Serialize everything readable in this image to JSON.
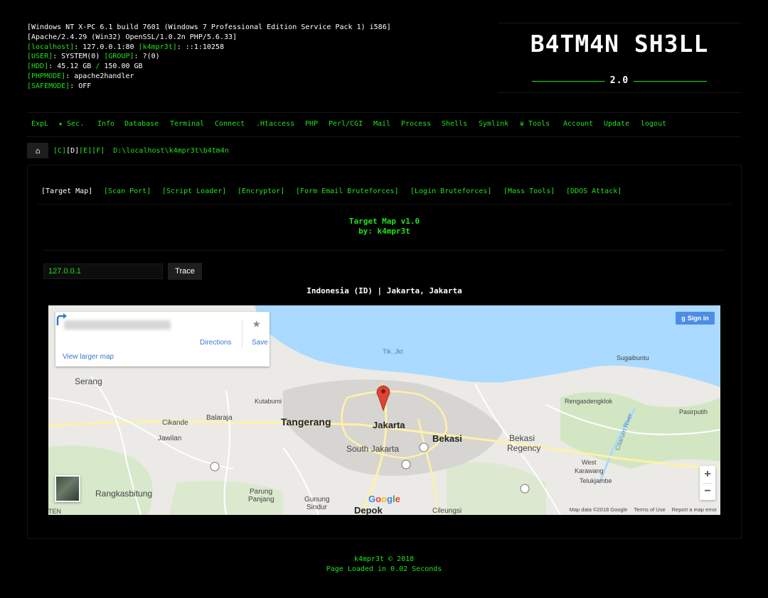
{
  "sysinfo": {
    "lines": [
      [
        {
          "t": "[Windows NT X-PC 6.1 build 7601 (Windows 7 Professional Edition Service Pack 1) i586]",
          "c": "w"
        }
      ],
      [
        {
          "t": "[Apache/2.4.29 (Win32) OpenSSL/1.0.2n PHP/5.6.33]",
          "c": "w"
        }
      ],
      [
        {
          "t": "[localhost]",
          "c": "g"
        },
        {
          "t": ": 127.0.0.1:80 ",
          "c": "w"
        },
        {
          "t": "[k4mpr3t]",
          "c": "g"
        },
        {
          "t": ": ::1:10258",
          "c": "w"
        }
      ],
      [
        {
          "t": "[USER]",
          "c": "g"
        },
        {
          "t": ": SYSTEM(0) ",
          "c": "w"
        },
        {
          "t": "[GROUP]",
          "c": "g"
        },
        {
          "t": ": ?(0)",
          "c": "w"
        }
      ],
      [
        {
          "t": "[HDD]",
          "c": "g"
        },
        {
          "t": ": 45.12 GB ",
          "c": "w"
        },
        {
          "t": "/",
          "c": "g"
        },
        {
          "t": " 150.00 GB",
          "c": "w"
        }
      ],
      [
        {
          "t": "[PHPMODE]",
          "c": "g"
        },
        {
          "t": ": apache2handler",
          "c": "w"
        }
      ],
      [
        {
          "t": "[SAFEMODE]",
          "c": "g"
        },
        {
          "t": ": OFF",
          "c": "w"
        }
      ]
    ]
  },
  "logo": {
    "title": "B4TM4N SH3LL",
    "version": "2.0"
  },
  "nav": {
    "items": [
      "ExpL",
      "★ Sec.",
      "Info",
      "Database",
      "Terminal",
      "Connect",
      ".Htaccess",
      "PHP",
      "Perl/CGI",
      "Mail",
      "Process",
      "Shells",
      "Symlink",
      "♛ Tools",
      "Account",
      "Update",
      "logout"
    ]
  },
  "pathbar": {
    "home_icon": "home-icon",
    "home_glyph": "⌂",
    "drives": [
      "[C]",
      "[D]",
      "[E]",
      "[F]"
    ],
    "current_drive": "[D]",
    "path": "D:\\localhost\\k4mpr3t\\b4tm4n"
  },
  "tools": {
    "items": [
      "[Target Map]",
      "[Scan Port]",
      "[Script Loader]",
      "[Encryptor]",
      "[Form Email Bruteforces]",
      "[Login Bruteforces]",
      "[Mass Tools]",
      "[DDOS Attack]"
    ],
    "active": "[Target Map]"
  },
  "target_map": {
    "title": "Target Map v1.0",
    "author": "by: k4mpr3t",
    "ip_value": "127.0.0.1",
    "trace_label": "Trace",
    "result": "Indonesia (ID) | Jakarta, Jakarta"
  },
  "map": {
    "directions_label": "Directions",
    "save_label": "Save",
    "view_larger": "View larger map",
    "signin_label": "Sign in",
    "zoom_in": "+",
    "zoom_out": "−",
    "google": "Google",
    "attribution": [
      "Map data ©2018 Google",
      "Terms of Use",
      "Report a map error"
    ],
    "places": [
      {
        "name": "Tlk. Jkt",
        "size": 9
      },
      {
        "name": "Sugaibuntu",
        "size": 9
      },
      {
        "name": "Serang",
        "size": 12
      },
      {
        "name": "Kutabumi",
        "size": 9
      },
      {
        "name": "Rengasdengklok",
        "size": 9
      },
      {
        "name": "Pasirputih",
        "size": 9
      },
      {
        "name": "Cikande",
        "size": 10
      },
      {
        "name": "Balaraja",
        "size": 10
      },
      {
        "name": "Tangerang",
        "size": 14
      },
      {
        "name": "Jakarta",
        "size": 13
      },
      {
        "name": "Citarum River",
        "size": 9
      },
      {
        "name": "Bekasi",
        "size": 13
      },
      {
        "name": "Bekasi",
        "size": 12
      },
      {
        "name": "Regency",
        "size": 12
      },
      {
        "name": "South Jakarta",
        "size": 12
      },
      {
        "name": "Jawilan",
        "size": 10
      },
      {
        "name": "West",
        "size": 9
      },
      {
        "name": "Karawang",
        "size": 9
      },
      {
        "name": "Telukjambe",
        "size": 9
      },
      {
        "name": "Rangkasbitung",
        "size": 12
      },
      {
        "name": "Parung",
        "size": 10
      },
      {
        "name": "Panjang",
        "size": 10
      },
      {
        "name": "Gunung",
        "size": 10
      },
      {
        "name": "Sindur",
        "size": 10
      },
      {
        "name": "Depok",
        "size": 13
      },
      {
        "name": "Cileungsi",
        "size": 10
      },
      {
        "name": "TEN",
        "size": 9
      }
    ]
  },
  "footer": {
    "credit": "k4mpr3t © 2018",
    "loaded": "Page Loaded in 0.02 Seconds"
  },
  "colors": {
    "accent": "#21e21b",
    "background": "#000000",
    "link_blue": "#3a76d3",
    "pin": "#db4437"
  }
}
